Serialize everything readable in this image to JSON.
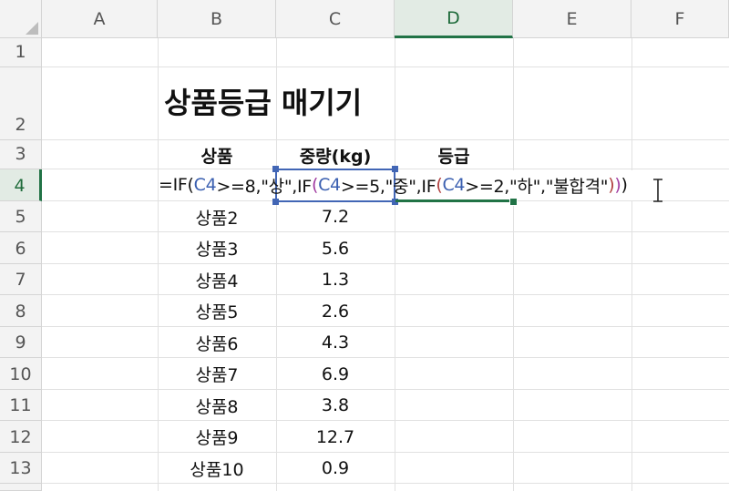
{
  "columns": [
    "A",
    "B",
    "C",
    "D",
    "E",
    "F"
  ],
  "active_column": "D",
  "rows": [
    "1",
    "2",
    "3",
    "4",
    "5",
    "6",
    "7",
    "8",
    "9",
    "10",
    "11",
    "12",
    "13"
  ],
  "active_row": "4",
  "title": "상품등급 매기기",
  "headers": {
    "product": "상품",
    "weight": "중량(kg)",
    "grade": "등급"
  },
  "formula": {
    "s1": "=IF(",
    "r1": "C4",
    "s2": ">=8,\"상\",IF",
    "q1": "(",
    "r2": "C4",
    "s3": ">=5,\"중\",IF",
    "q2": "(",
    "r3": "C4",
    "s4": ">=2,\"하\",\"불합격\"",
    "c3": ")",
    "c2": ")",
    "c1": ")"
  },
  "data_rows": [
    {
      "product": "상품2",
      "weight": "7.2"
    },
    {
      "product": "상품3",
      "weight": "5.6"
    },
    {
      "product": "상품4",
      "weight": "1.3"
    },
    {
      "product": "상품5",
      "weight": "2.6"
    },
    {
      "product": "상품6",
      "weight": "4.3"
    },
    {
      "product": "상품7",
      "weight": "6.9"
    },
    {
      "product": "상품8",
      "weight": "3.8"
    },
    {
      "product": "상품9",
      "weight": "12.7"
    },
    {
      "product": "상품10",
      "weight": "0.9"
    }
  ],
  "colors": {
    "accent": "#217346",
    "reference": "#4266b5"
  },
  "cursor_icon": "text-cursor-icon"
}
